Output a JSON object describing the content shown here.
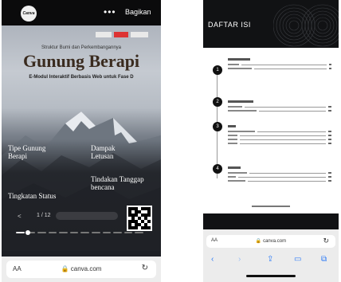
{
  "left_phone": {
    "topbar": {
      "app_logo_text": "Canva",
      "more_label": "•••",
      "share_label": "Bagikan"
    },
    "cover": {
      "subtitle": "Struktur Bumi dan Perkembangannya",
      "title": "Gunung Berapi",
      "tagline": "E-Modul Interaktif Berbasis Web untuk Fase D"
    },
    "sections": {
      "tipe": {
        "title_1": "Tipe Gunung",
        "title_2": "Berapi"
      },
      "dampak": {
        "title_1": "Dampak",
        "title_2": "Letusan"
      },
      "tindakan": {
        "title_1": "Tindakan Tanggap",
        "title_2": "bencana"
      },
      "tingkatan": {
        "title": "Tingkatan Status"
      }
    },
    "pager": {
      "prev": "<",
      "page": "1 / 12",
      "next": ">"
    },
    "progress": {
      "current_page": 1,
      "total_pages": 12
    },
    "browser": {
      "aa_label": "AA",
      "url": "canva.com",
      "reload_icon": "↻"
    }
  },
  "right_phone": {
    "header": {
      "title": "DAFTAR ISI"
    },
    "toc": [
      {
        "number": "1",
        "rows": [
          {
            "label": "",
            "page": ""
          },
          {
            "label": "",
            "page": ""
          }
        ]
      },
      {
        "number": "2",
        "rows": [
          {
            "label": "",
            "page": ""
          },
          {
            "label": "",
            "page": ""
          }
        ]
      },
      {
        "number": "3",
        "rows": [
          {
            "label": "",
            "page": ""
          },
          {
            "label": "",
            "page": ""
          },
          {
            "label": "",
            "page": ""
          },
          {
            "label": "",
            "page": ""
          }
        ]
      },
      {
        "number": "4",
        "rows": [
          {
            "label": "",
            "page": ""
          },
          {
            "label": "",
            "page": ""
          },
          {
            "label": "",
            "page": ""
          }
        ]
      }
    ],
    "footer_url": "",
    "browser": {
      "aa_label": "AA",
      "url": "canva.com",
      "reload_icon": "↻",
      "back_icon": "‹",
      "forward_icon": "›",
      "share_icon": "⇪",
      "bookmarks_icon": "▭",
      "tabs_icon": "⧉"
    }
  },
  "colors": {
    "dark_bg": "#111214",
    "ios_blue": "#2f7cf6",
    "title_brown": "#3a2b1f"
  }
}
